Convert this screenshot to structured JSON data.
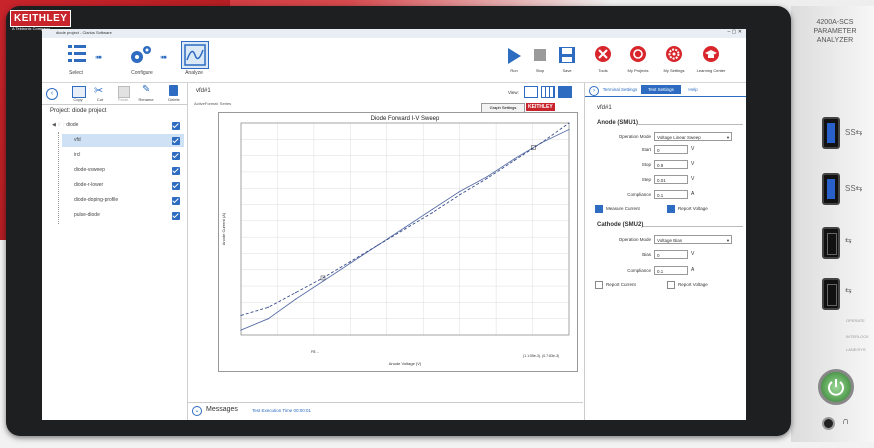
{
  "brand": {
    "logo": "KEITHLEY",
    "tagline": "A Tektronix Company"
  },
  "device": {
    "model": "4200A-SCS",
    "subtitle": "PARAMETER ANALYZER",
    "usb_ports": [
      {
        "label": "SS⇆"
      },
      {
        "label": "SS⇆"
      },
      {
        "label": "⇆"
      },
      {
        "label": "⇆"
      }
    ],
    "leds": [
      "OPERATE",
      "INTERLOCK",
      "LANE/SYS"
    ]
  },
  "window": {
    "title": "diode project - Clarius Software"
  },
  "workflow": {
    "steps": [
      {
        "label": "Select"
      },
      {
        "label": "Configure"
      },
      {
        "label": "Analyze"
      }
    ]
  },
  "toolbar": {
    "run": "Run",
    "stop": "Stop",
    "save": "Save",
    "tools": "Tools",
    "my_projects": "My Projects",
    "my_settings": "My Settings",
    "learning_center": "Learning Center"
  },
  "left_panel": {
    "buttons": [
      "Copy",
      "Cut",
      "Paste",
      "Rename",
      "Delete"
    ],
    "project_label": "Project: diode project",
    "root": "diode",
    "items": [
      "vfd",
      "ircl",
      "diode-vsweep",
      "diode-r-lower",
      "diode-doping-profile",
      "pulse-diode"
    ]
  },
  "center": {
    "test_name": "vfd#1",
    "view_label": "View:",
    "graph_settings_btn": "Graph Settings",
    "watermark": "KEITHLEY",
    "table_label": "ActiveFormat: Series"
  },
  "chart_data": {
    "type": "line",
    "title": "Diode Forward I-V Sweep",
    "xlabel": "Anode Voltage (V)",
    "ylabel": "Anode Current (A)",
    "series": [
      {
        "x": [
          0,
          0.1,
          0.2,
          0.3,
          0.4,
          0.5,
          0.6,
          0.7,
          0.8,
          0.9,
          1.0,
          1.1,
          1.2
        ],
        "y": [
          3,
          10,
          22,
          33,
          44,
          55,
          66,
          77,
          88,
          97,
          108,
          118,
          126
        ]
      },
      {
        "x": [
          0,
          0.1,
          0.2,
          0.3,
          0.4,
          0.5,
          0.6,
          0.7,
          0.8,
          0.9,
          1.0,
          1.1,
          1.2
        ],
        "y": [
          12,
          17,
          26,
          35,
          45,
          55,
          65,
          75,
          86,
          96,
          107,
          118,
          130
        ]
      }
    ],
    "legend_text": "(1.1:55e-3), (0.7:83e-3)",
    "note_text": "FB ..."
  },
  "messages": {
    "label": "Messages",
    "status": "Test Execution Time 00:00:01"
  },
  "config": {
    "tabs": [
      "Test Settings",
      "Terminal Settings",
      "Help"
    ],
    "active_tab": "Test Settings",
    "test_name": "vfd#1",
    "anode": {
      "title": "Anode (SMU1)",
      "operation_mode_label": "Operation Mode",
      "operation_mode": "Voltage Linear Sweep",
      "start_label": "Start",
      "start": "0",
      "stop_label": "Stop",
      "stop": "0.9",
      "step_label": "Step",
      "step": "0.01",
      "compliance_label": "Compliance",
      "compliance": "0.1",
      "measure_current": "Measure Current",
      "report_voltage": "Report Voltage"
    },
    "cathode": {
      "title": "Cathode (SMU2)",
      "operation_mode_label": "Operation Mode",
      "operation_mode": "Voltage Bias",
      "bias_label": "Bias",
      "bias": "0",
      "compliance_label": "Compliance",
      "compliance": "0.1",
      "report_current": "Report Current",
      "report_voltage": "Report Voltage"
    },
    "units": {
      "v": "V",
      "a": "A"
    }
  }
}
